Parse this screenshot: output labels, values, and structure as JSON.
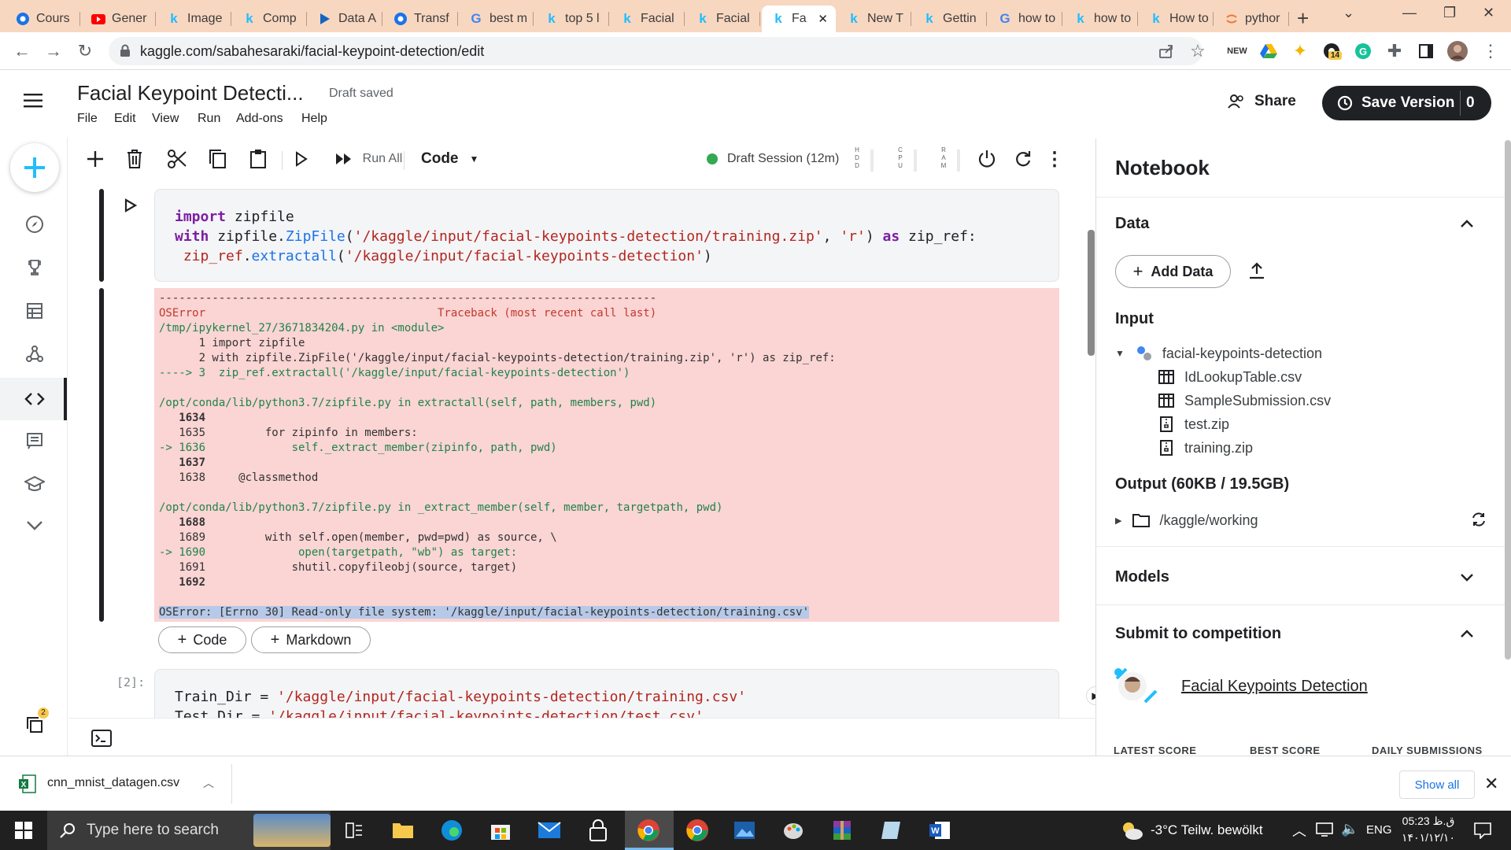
{
  "browser": {
    "tabs": [
      {
        "label": "Cours",
        "icon": "chrome-icon",
        "color": "#1a73e8"
      },
      {
        "label": "Gener",
        "icon": "youtube-icon",
        "color": "#ff0000"
      },
      {
        "label": "Image",
        "icon": "kaggle-icon",
        "color": "#20beff"
      },
      {
        "label": "Comp",
        "icon": "kaggle-icon",
        "color": "#20beff"
      },
      {
        "label": "Data A",
        "icon": "play-icon",
        "color": "#1565c0"
      },
      {
        "label": "Transf",
        "icon": "chrome-icon",
        "color": "#1a73e8"
      },
      {
        "label": "best m",
        "icon": "google-icon",
        "color": "#4285f4"
      },
      {
        "label": "top 5 l",
        "icon": "kaggle-icon",
        "color": "#20beff"
      },
      {
        "label": "Facial",
        "icon": "kaggle-icon",
        "color": "#20beff"
      },
      {
        "label": "Facial",
        "icon": "kaggle-icon",
        "color": "#20beff"
      },
      {
        "label": "Fa",
        "icon": "kaggle-icon",
        "color": "#20beff",
        "active": true
      },
      {
        "label": "New T",
        "icon": "kaggle-icon",
        "color": "#20beff"
      },
      {
        "label": "Gettin",
        "icon": "kaggle-icon",
        "color": "#20beff"
      },
      {
        "label": "how to",
        "icon": "google-icon",
        "color": "#4285f4"
      },
      {
        "label": "how to",
        "icon": "kaggle-icon",
        "color": "#20beff"
      },
      {
        "label": "How to",
        "icon": "kaggle-icon",
        "color": "#20beff"
      },
      {
        "label": "pythor",
        "icon": "jupyter-icon",
        "color": "#f37726"
      }
    ],
    "url": "kaggle.com/sabahesaraki/facial-keypoint-detection/edit",
    "ext_badge": "14"
  },
  "header": {
    "title": "Facial Keypoint Detecti...",
    "status": "Draft saved",
    "menus": [
      "File",
      "Edit",
      "View",
      "Run",
      "Add-ons",
      "Help"
    ],
    "share": "Share",
    "save_version": "Save Version",
    "version_count": "0"
  },
  "toolbar": {
    "run_all": "Run All",
    "cell_type": "Code",
    "session": "Draft Session (12m)",
    "meters": [
      "H\nD\nD",
      "C\nP\nU",
      "R\nA\nM"
    ],
    "session_color": "#34a853"
  },
  "cells": {
    "code1": "import zipfile\nwith zipfile.ZipFile('/kaggle/input/facial-keypoints-detection/training.zip', 'r') as zip_ref:\n zip_ref.extractall('/kaggle/input/facial-keypoints-detection')",
    "error_lines": [
      "---------------------------------------------------------------------------",
      "OSError                                   Traceback (most recent call last)",
      "/tmp/ipykernel_27/3671834204.py in <module>",
      "      1 import zipfile",
      "      2 with zipfile.ZipFile('/kaggle/input/facial-keypoints-detection/training.zip', 'r') as zip_ref:",
      "----> 3  zip_ref.extractall('/kaggle/input/facial-keypoints-detection')",
      "",
      "/opt/conda/lib/python3.7/zipfile.py in extractall(self, path, members, pwd)",
      "   1634 ",
      "   1635         for zipinfo in members:",
      "-> 1636             self._extract_member(zipinfo, path, pwd)",
      "   1637 ",
      "   1638     @classmethod",
      "",
      "/opt/conda/lib/python3.7/zipfile.py in _extract_member(self, member, targetpath, pwd)",
      "   1688 ",
      "   1689         with self.open(member, pwd=pwd) as source, \\",
      "-> 1690              open(targetpath, \"wb\") as target:",
      "   1691             shutil.copyfileobj(source, target)",
      "   1692 ",
      "",
      "OSError: [Errno 30] Read-only file system: '/kaggle/input/facial-keypoints-detection/training.csv'"
    ],
    "add_code": "Code",
    "add_markdown": "Markdown",
    "cell2_prompt": "[2]:",
    "code2": "Train_Dir = '/kaggle/input/facial-keypoints-detection/training.csv'\nTest_Dir = '/kaggle/input/facial-keypoints-detection/test.csv'"
  },
  "panel": {
    "title": "Notebook",
    "data_heading": "Data",
    "add_data": "Add Data",
    "input_heading": "Input",
    "dataset": "facial-keypoints-detection",
    "files": [
      {
        "name": "IdLookupTable.csv",
        "icon": "table-icon"
      },
      {
        "name": "SampleSubmission.csv",
        "icon": "table-icon"
      },
      {
        "name": "test.zip",
        "icon": "zip-icon"
      },
      {
        "name": "training.zip",
        "icon": "zip-icon"
      }
    ],
    "output_heading": "Output (60KB / 19.5GB)",
    "output_folder": "/kaggle/working",
    "models_heading": "Models",
    "submit_heading": "Submit to competition",
    "competition": "Facial Keypoints Detection",
    "score_labels": [
      "LATEST SCORE",
      "BEST SCORE",
      "DAILY SUBMISSIONS"
    ]
  },
  "downloads": {
    "file": "cnn_mnist_datagen.csv",
    "show_all": "Show all"
  },
  "taskbar": {
    "search_placeholder": "Type here to search",
    "weather": "-3°C  Teilw. bewölkt",
    "lang": "ENG",
    "time": "05:23 ق.ظ",
    "date": "۱۴۰۱/۱۲/۱۰",
    "rail_badge": "2"
  }
}
